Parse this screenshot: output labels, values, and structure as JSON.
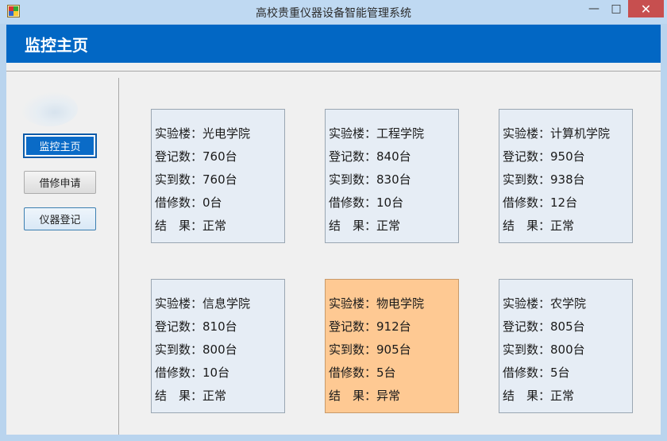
{
  "window": {
    "title": "高校贵重仪器设备智能管理系统"
  },
  "header": {
    "title": "监控主页"
  },
  "nav": {
    "monitor": "监控主页",
    "repair": "借修申请",
    "register": "仪器登记"
  },
  "labels": {
    "building": "实验楼：",
    "registered": "登记数：",
    "present": "实到数：",
    "repairing": "借修数：",
    "result": "结　果："
  },
  "cards": [
    {
      "building": "光电学院",
      "registered": "760台",
      "present": "760台",
      "repairing": "0台",
      "result": "正常"
    },
    {
      "building": "工程学院",
      "registered": "840台",
      "present": "830台",
      "repairing": "10台",
      "result": "正常"
    },
    {
      "building": "计算机学院",
      "registered": "950台",
      "present": "938台",
      "repairing": "12台",
      "result": "正常"
    },
    {
      "building": "信息学院",
      "registered": "810台",
      "present": "800台",
      "repairing": "10台",
      "result": "正常"
    },
    {
      "building": "物电学院",
      "registered": "912台",
      "present": "905台",
      "repairing": "5台",
      "result": "异常"
    },
    {
      "building": "农学院",
      "registered": "805台",
      "present": "800台",
      "repairing": "5台",
      "result": "正常"
    }
  ],
  "colors": {
    "header": "#0267c4",
    "card_normal": "#e6edf5",
    "card_alert": "#fec993",
    "close": "#c74f4f"
  },
  "icons": {
    "app": "app-icon",
    "minimize": "minimize-icon",
    "maximize": "maximize-icon",
    "close": "close-icon"
  }
}
